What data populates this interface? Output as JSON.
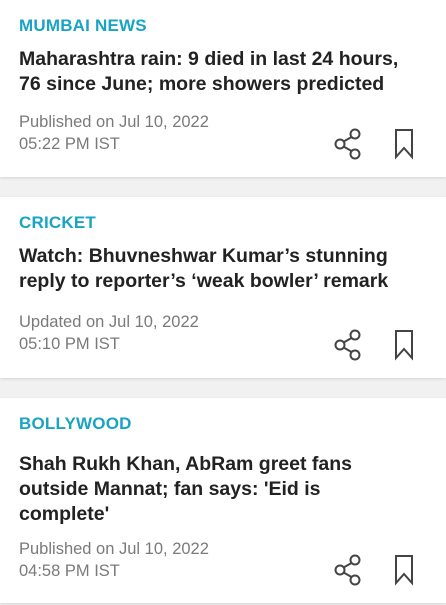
{
  "articles": [
    {
      "category": "MUMBAI NEWS",
      "headline": "Maharashtra rain: 9 died in last 24 hours, 76 since June; more showers predicted",
      "date_line": "Published on Jul 10, 2022",
      "time_line": "05:22 PM IST",
      "share_icon": "share-icon",
      "bookmark_icon": "bookmark-icon"
    },
    {
      "category": "CRICKET",
      "headline": "Watch: Bhuvneshwar Kumar’s stunning reply to reporter’s ‘weak bowler’ remark",
      "date_line": "Updated on Jul 10, 2022",
      "time_line": "05:10 PM IST",
      "share_icon": "share-icon",
      "bookmark_icon": "bookmark-icon"
    },
    {
      "category": "BOLLYWOOD",
      "headline": "Shah Rukh Khan, AbRam greet fans outside Mannat; fan says: 'Eid is complete'",
      "date_line": "Published on Jul 10, 2022",
      "time_line": "04:58 PM IST",
      "share_icon": "share-icon",
      "bookmark_icon": "bookmark-icon"
    }
  ],
  "colors": {
    "category": "#19a3c4",
    "headline": "#222222",
    "meta": "#7a7a7a",
    "icon": "#444444",
    "background": "#f1f1f1"
  }
}
